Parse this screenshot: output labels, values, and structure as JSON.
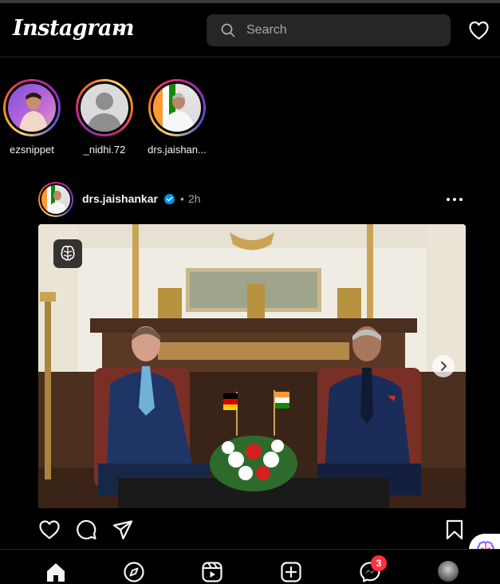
{
  "app": {
    "name": "Instagram"
  },
  "header": {
    "logo_text": "Instagram",
    "search_placeholder": "Search"
  },
  "stories": [
    {
      "username": "ezsnippet"
    },
    {
      "username": "_nidhi.72"
    },
    {
      "username": "drs.jaishan..."
    }
  ],
  "post": {
    "username": "drs.jaishankar",
    "verified": true,
    "separator": "•",
    "time": "2h",
    "ai_badge_icon": "ai-brain-icon"
  },
  "bottom_nav": {
    "items": [
      "home-icon",
      "explore-icon",
      "reels-icon",
      "create-icon",
      "messenger-icon",
      "profile-avatar"
    ],
    "messages_badge": "3"
  },
  "colors": {
    "background": "#000000",
    "surface": "#262626",
    "text": "#f5f5f5",
    "muted": "#a8a8a8",
    "verified": "#0095f6",
    "notification": "#ff3040"
  }
}
